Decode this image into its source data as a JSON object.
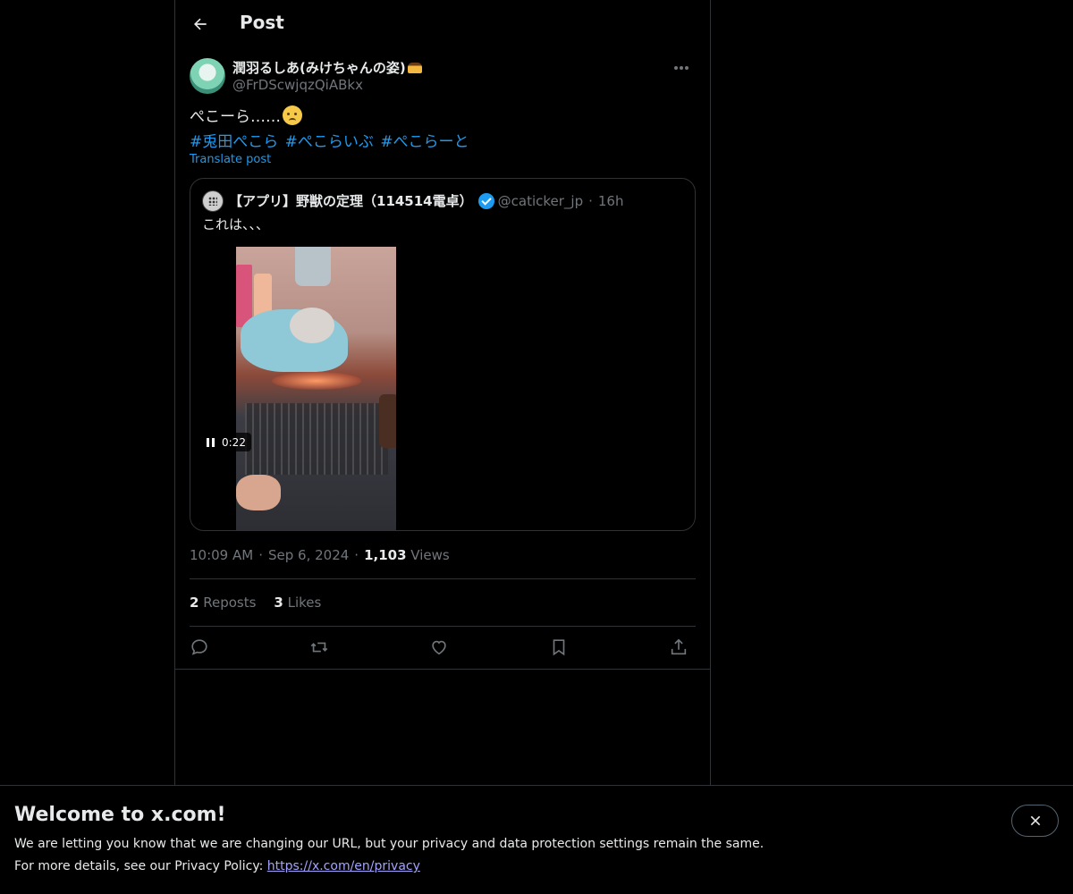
{
  "header": {
    "title": "Post",
    "back_icon": "arrow-left-icon"
  },
  "post": {
    "author_name": "潤羽るしあ(みけちゃんの姿)",
    "author_handle": "@FrDScwjqzQiABkx",
    "text": "ぺこーら……",
    "hashtags": [
      "#兎田ぺこら",
      "#ぺこらいぶ",
      "#ぺこらーと"
    ],
    "translate_label": "Translate post",
    "time": "10:09 AM",
    "date": "Sep 6, 2024",
    "views_count": "1,103",
    "views_label": "Views",
    "reposts_count": "2",
    "reposts_label": "Reposts",
    "likes_count": "3",
    "likes_label": "Likes"
  },
  "quote": {
    "name": "【アプリ】野獣の定理（114514電卓）",
    "handle": "@caticker_jp",
    "separator": "·",
    "time": "16h",
    "text": "これは、、、",
    "video_time": "0:22"
  },
  "actions": [
    "reply-icon",
    "repost-icon",
    "like-icon",
    "bookmark-icon",
    "share-icon"
  ],
  "banner": {
    "title": "Welcome to x.com!",
    "line1": "We are letting you know that we are changing our URL, but your privacy and data protection settings remain the same.",
    "line2_prefix": "For more details, see our Privacy Policy: ",
    "link": "https://x.com/en/privacy"
  },
  "colors": {
    "accent": "#1d9bf0",
    "muted": "#71767b",
    "text": "#e7e9ea",
    "border": "#2f3336"
  }
}
